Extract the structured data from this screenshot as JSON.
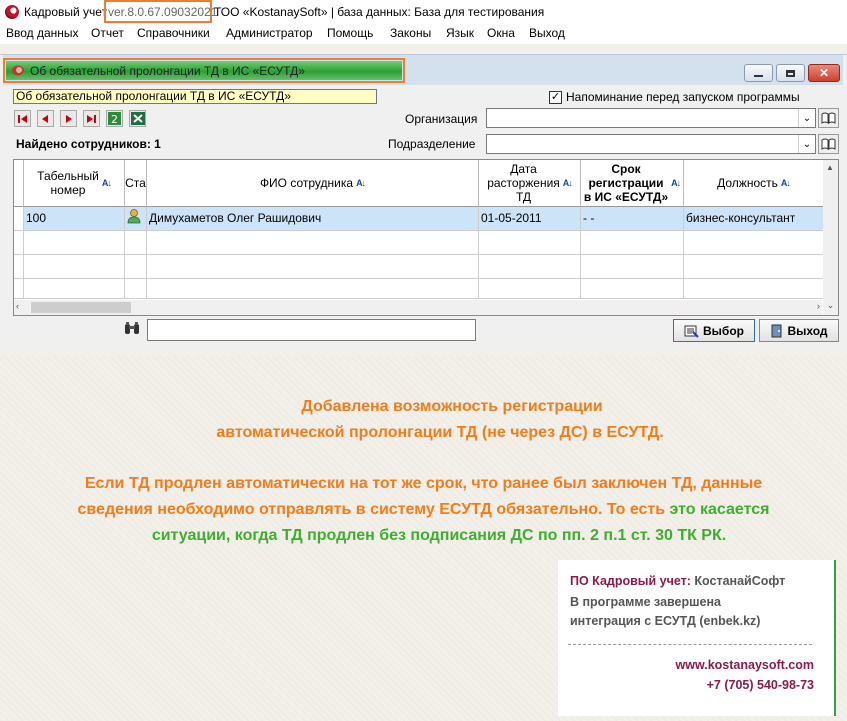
{
  "titlebar": {
    "prefix": "Кадровый учет",
    "version": "ver.8.0.67.09032021",
    "suffix": "ТОО «KostanaySoft» | база данных: База для тестирования"
  },
  "menu": [
    "Ввод данных",
    "Отчет",
    "Справочники",
    "Администратор",
    "Помощь",
    "Законы",
    "Язык",
    "Окна",
    "Выход"
  ],
  "window": {
    "title": "Об обязательной пролонгации ТД в ИС «ЕСУТД»"
  },
  "form": {
    "hint": "Об обязательной пролонгации ТД в ИС «ЕСУТД»",
    "reminder_label": "Напоминание перед запуском программы",
    "reminder_checked": true,
    "found_label": "Найдено сотрудников: 1",
    "org_label": "Организация",
    "org_value": "",
    "subdivision_label": "Подразделение",
    "subdivision_value": ""
  },
  "grid": {
    "columns": [
      {
        "line1": "Табельный",
        "line2": "номер"
      },
      {
        "line1": "Ста"
      },
      {
        "line1": "ФИО сотрудника"
      },
      {
        "line1": "Дата",
        "line2": "расторжения",
        "line3": "ТД"
      },
      {
        "line1": "Срок",
        "line2": "регистрации",
        "line3": "в ИС «ЕСУТД»"
      },
      {
        "line1": "Должность"
      }
    ],
    "rows": [
      {
        "tab": "100",
        "status": "person-icon",
        "fio": "Димухаметов Олег Рашидович",
        "date": "01-05-2011",
        "term": "- -",
        "position": "бизнес-консультант"
      }
    ]
  },
  "search": {
    "value": ""
  },
  "buttons": {
    "select": "Выбор",
    "exit": "Выход"
  },
  "promo": {
    "line1": "Добавлена возможность регистрации",
    "line2": "автоматической пролонгации ТД (не через ДС) в ЕСУТД.",
    "line3": "Если ТД продлен автоматически на тот же срок, что ранее был заключен ТД, данные",
    "line4a": "сведения необходимо отправлять в систему ЕСУТД обязательно. То есть ",
    "line4b": "это касается",
    "line5": "ситуации, когда ТД продлен без подписания ДС по пп. 2 п.1 ст. 30 ТК РК."
  },
  "card": {
    "brand_prefix": "ПО Кадровый учет:",
    "brand_name": "КостанайСофт",
    "text1": "В программе завершена",
    "text2": "интеграция с ЕСУТД (enbek.kz)",
    "website": "www.kostanaysoft.com",
    "phone": "+7 (705) 540-98-73"
  },
  "colors": {
    "accent_orange": "#f07d1a",
    "accent_green": "#3fae2f",
    "brand_maroon": "#8b1a4a",
    "selected_row": "#cde3f7"
  }
}
